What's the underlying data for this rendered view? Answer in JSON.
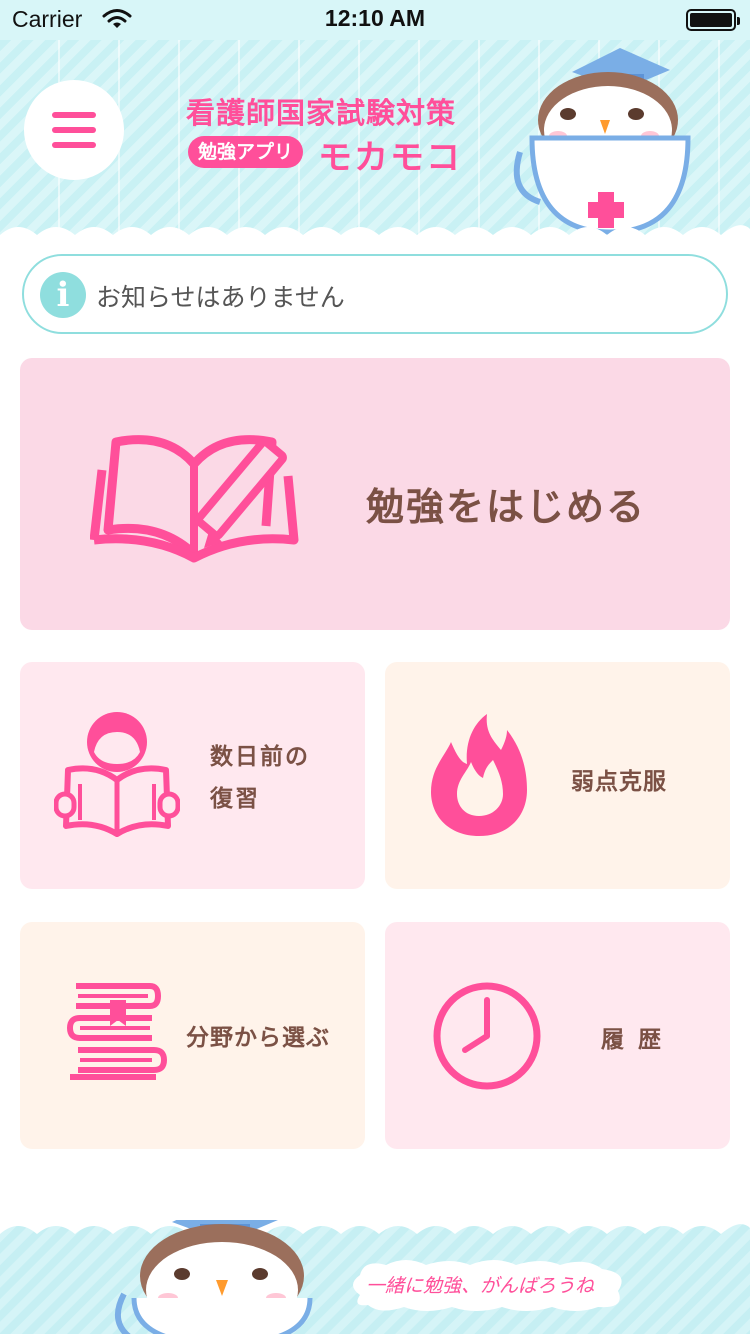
{
  "status_bar": {
    "carrier": "Carrier",
    "time": "12:10 AM"
  },
  "header": {
    "title_line1": "看護師国家試験対策",
    "app_badge": "勉強アプリ",
    "app_name": "モカモコ",
    "menu_icon": "hamburger-menu-icon",
    "mascot": "owl-in-cup-mascot"
  },
  "notice": {
    "icon": "info-icon",
    "info_glyph": "i",
    "text": "お知らせはありません"
  },
  "cards": {
    "start_study": {
      "label": "勉強をはじめる",
      "icon": "book-pencil-icon"
    },
    "review": {
      "label_line1": "数日前の",
      "label_line2": "復習",
      "icon": "reading-person-icon"
    },
    "weakness": {
      "label": "弱点克服",
      "icon": "flame-icon"
    },
    "by_field": {
      "label": "分野から選ぶ",
      "icon": "stacked-books-icon"
    },
    "history": {
      "label": "履歴",
      "icon": "clock-icon"
    }
  },
  "footer": {
    "message": "一緒に勉強、がんばろうね",
    "mascot": "owl-in-cup-mascot"
  },
  "colors": {
    "accent_pink": "#ff4f9a",
    "label_brown": "#7b5145",
    "header_cyan": "#d8f6f8",
    "notice_border": "#8fdede",
    "card_pink": "#fbd9e6",
    "card_light_pink": "#ffe8ef",
    "card_cream": "#fff3ea"
  }
}
